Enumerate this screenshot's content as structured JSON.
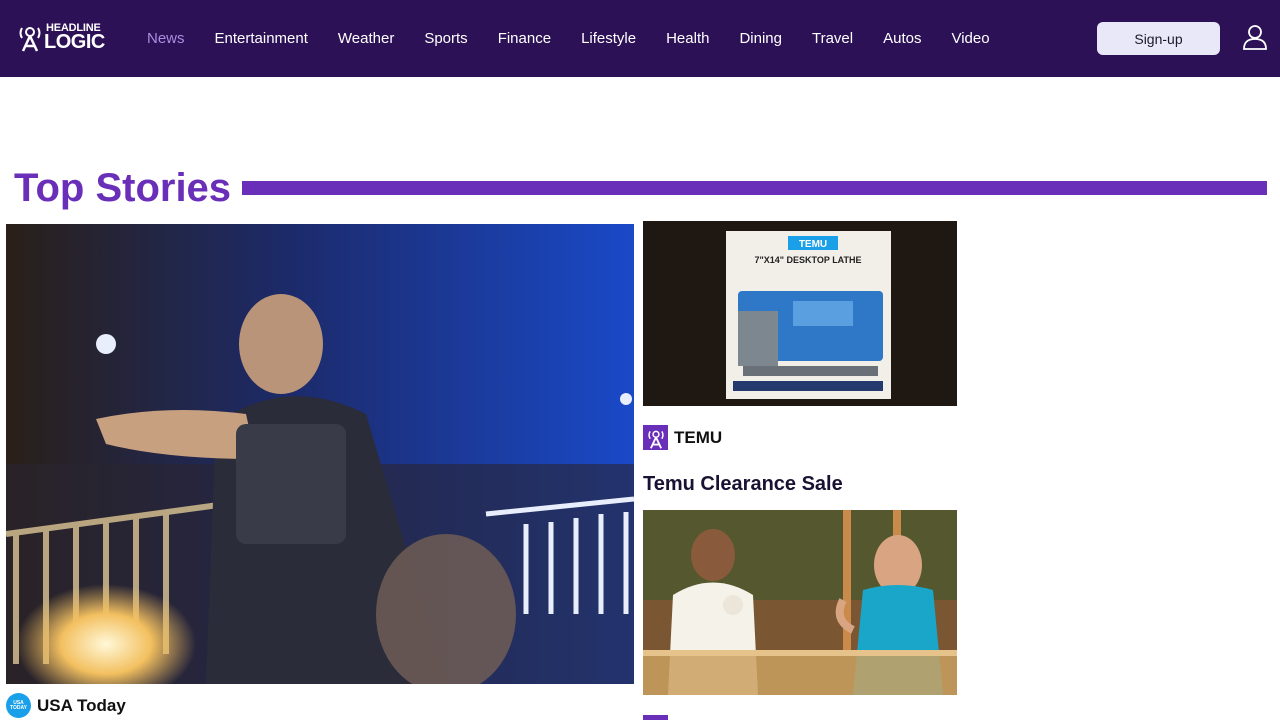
{
  "header": {
    "logo_line1": "HEADLINE",
    "logo_line2": "LOGIC",
    "nav_items": [
      {
        "label": "News",
        "active": true
      },
      {
        "label": "Entertainment"
      },
      {
        "label": "Weather"
      },
      {
        "label": "Sports"
      },
      {
        "label": "Finance"
      },
      {
        "label": "Lifestyle"
      },
      {
        "label": "Health"
      },
      {
        "label": "Dining"
      },
      {
        "label": "Travel"
      },
      {
        "label": "Autos"
      },
      {
        "label": "Video"
      }
    ],
    "signup_label": "Sign-up",
    "user_icon": "user-icon"
  },
  "colors": {
    "header_bg": "#2d1156",
    "accent": "#6a2fb8",
    "active_nav": "#a98de0"
  },
  "section": {
    "title": "Top Stories"
  },
  "main_story": {
    "image_desc": "police-bodycam-still",
    "source": "USA Today",
    "source_badge": "USA TODAY"
  },
  "side_story_1": {
    "image_desc": "desktop-lathe-ad",
    "image_caption": "TEMU",
    "image_sub": "7\"X14\" DESKTOP LATHE",
    "source": "TEMU",
    "title": "Temu Clearance Sale"
  },
  "side_story_2": {
    "image_desc": "talk-show-panel"
  }
}
